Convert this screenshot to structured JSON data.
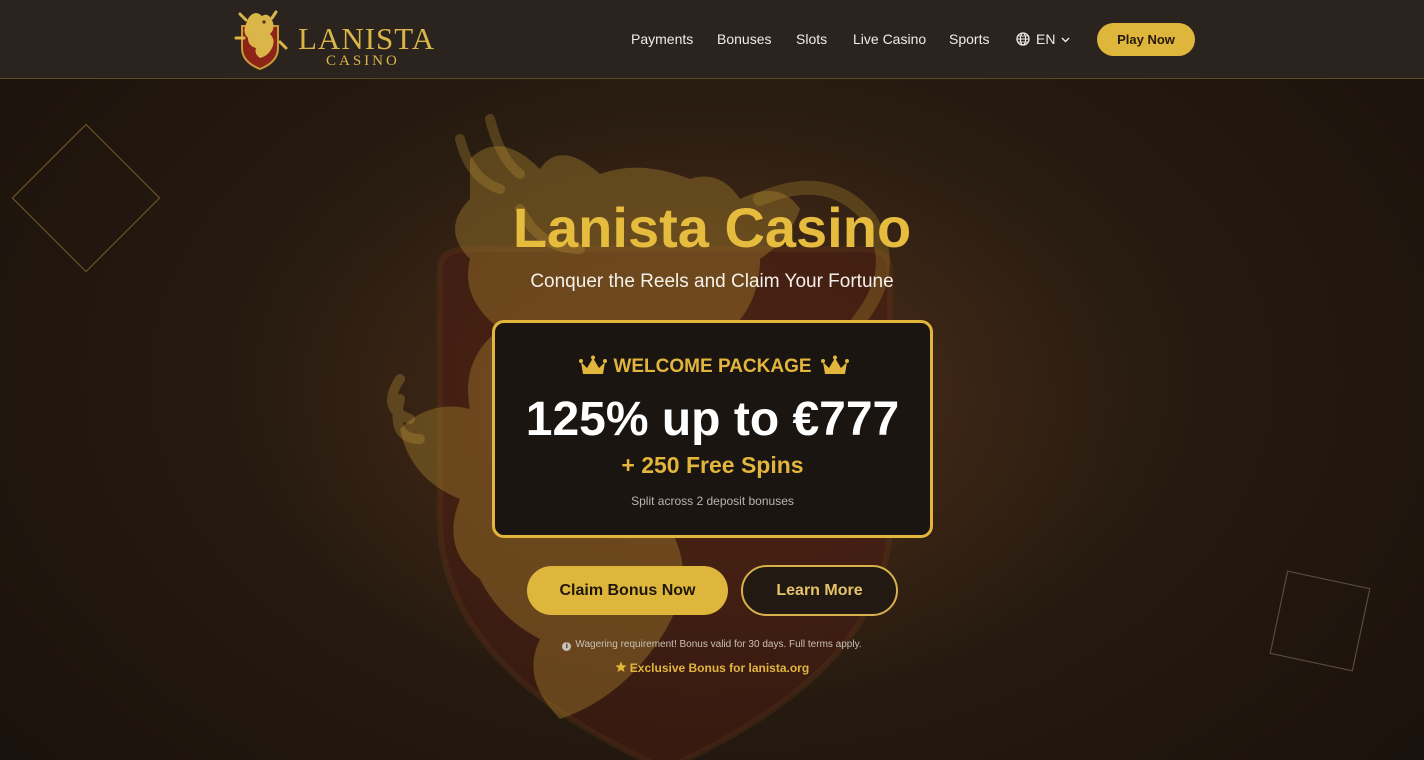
{
  "brand": {
    "name": "LANISTA",
    "sub": "CASINO",
    "logo_icon": "lion-crest-icon",
    "gold": "#dfb63c",
    "dark": "#1c1510"
  },
  "nav": {
    "items": [
      {
        "label": "Payments"
      },
      {
        "label": "Bonuses"
      },
      {
        "label": "Slots"
      },
      {
        "label": "Live Casino"
      },
      {
        "label": "Sports"
      }
    ],
    "language": "EN",
    "language_icon": "globe-icon",
    "play_label": "Play Now"
  },
  "hero": {
    "title": "Lanista Casino",
    "subtitle": "Conquer the Reels and Claim Your Fortune",
    "background_icon": "rampant-lion-shield-icon"
  },
  "offer": {
    "label": "WELCOME PACKAGE",
    "label_icon": "crown-icon",
    "main": "125% up to €777",
    "spins": "+ 250 Free Spins",
    "note": "Split across 2 deposit bonuses"
  },
  "actions": {
    "claim_label": "Claim Bonus Now",
    "learn_label": "Learn More"
  },
  "footer_notes": {
    "disclaimer": "Wagering requirement! Bonus valid for 30 days. Full terms apply.",
    "disclaimer_icon": "info-icon",
    "exclusive": "Exclusive Bonus for lanista.org",
    "exclusive_icon": "star-icon"
  }
}
